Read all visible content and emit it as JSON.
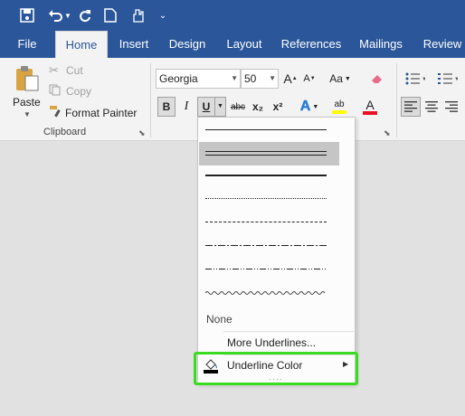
{
  "qat": {
    "icons": [
      "save-icon",
      "undo-icon",
      "redo-icon",
      "new-document-icon",
      "touch-mode-icon",
      "customize-icon"
    ]
  },
  "tabs": [
    "File",
    "Home",
    "Insert",
    "Design",
    "Layout",
    "References",
    "Mailings",
    "Review"
  ],
  "clipboard": {
    "paste": "Paste",
    "cut": "Cut",
    "copy": "Copy",
    "format_painter": "Format Painter",
    "group_label": "Clipboard"
  },
  "font": {
    "name": "Georgia",
    "size": "50"
  },
  "font_buttons": {
    "bold": "B",
    "italic": "I",
    "underline": "U",
    "strike": "abc",
    "subscript": "x₂",
    "superscript": "x²",
    "grow": "A",
    "shrink": "A",
    "case": "Aa"
  },
  "menu": {
    "none_label": "None",
    "more_label": "More Underlines...",
    "color_label": "Underline Color",
    "styles": [
      "single",
      "double",
      "thick",
      "dotted",
      "dashed",
      "dash-dot",
      "dash-dot-dot",
      "wave"
    ]
  },
  "colors": {
    "ribbon": "#2b579a",
    "highlight": "#c5c5c5",
    "focus_outline": "#3adb22",
    "font_color_bar": "#e81123",
    "highlight_bar": "#ffff00"
  }
}
